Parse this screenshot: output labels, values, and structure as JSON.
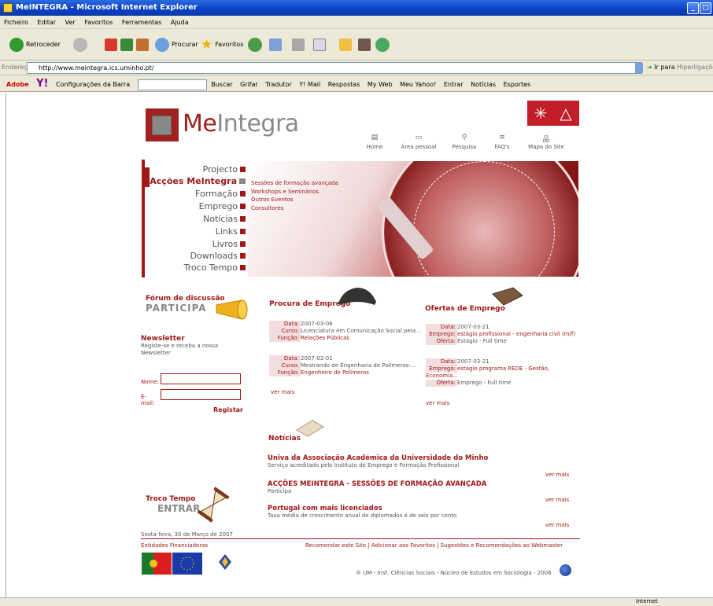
{
  "window": {
    "title": "MeINTEGRA - Microsoft Internet Explorer"
  },
  "menubar": [
    "Ficheiro",
    "Editar",
    "Ver",
    "Favoritos",
    "Ferramentas",
    "Ajuda"
  ],
  "toolbar": {
    "back": "Retroceder",
    "search": "Procurar",
    "favorites": "Favoritos"
  },
  "address": {
    "label": "Endereço",
    "url": "http://www.meintegra.ics.uminho.pt/",
    "go": "Ir para",
    "links": "Hiperligações"
  },
  "linksbar": {
    "adobe": "Adobe",
    "yahoo": "Y!",
    "config": "Configurações da Barra",
    "buscar": "Buscar",
    "grifar": "Grifar",
    "tradutor": "Tradutor",
    "ymail": "Y! Mail",
    "respostas": "Respostas",
    "myweb": "My Web",
    "meuyahoo": "Meu Yahoo!",
    "entrar": "Entrar",
    "noticias": "Notícias",
    "esportes": "Esportes"
  },
  "site": {
    "logo": {
      "prefix": "Me",
      "suffix": "Integra"
    },
    "topnav": [
      {
        "label": "Home",
        "icon": "home-icon"
      },
      {
        "label": "Área pessoal",
        "icon": "personal-icon"
      },
      {
        "label": "Pesquisa",
        "icon": "search-icon"
      },
      {
        "label": "FAQ's",
        "icon": "faq-icon"
      },
      {
        "label": "Mapa do Site",
        "icon": "sitemap-icon"
      }
    ],
    "menu": [
      "Projecto",
      "Acções MeIntegra",
      "Formação",
      "Emprego",
      "Notícias",
      "Links",
      "Livros",
      "Downloads",
      "Troco Tempo"
    ],
    "submenu": [
      "Sessões de formação avançada",
      "Workshops e Seminários",
      "Outros Eventos",
      "Consultores"
    ],
    "forum": {
      "title": "Fórum de discussão",
      "action": "PARTICIPA"
    },
    "newsletter": {
      "title": "Newsletter",
      "desc": "Registe-se e receba a nossa Newsletter",
      "name_label": "Nome:",
      "email_label": "E-mail:",
      "button": "Registar"
    },
    "procura": {
      "title": "Procura de Emprego",
      "items": [
        {
          "data": "2007-03-06",
          "curso": "Licenciatura em Comunicação Social pela...",
          "funcao": "Relações Públicas"
        },
        {
          "data": "2007-02-01",
          "curso": "Mestrando de Engenharia de Polímeros-...",
          "funcao": "Engenheiro de Polímeros"
        }
      ],
      "more": "ver mais"
    },
    "ofertas": {
      "title": "Ofertas de Emprego",
      "items": [
        {
          "data": "2007-03-21",
          "emprego": "estágio profissional - engenharia civil (m/f)",
          "oferta": "Estágio - Full time"
        },
        {
          "data": "2007-03-21",
          "emprego": "estágio programa REDE - Gestão,",
          "emprego2": "Economia...",
          "oferta": "Emprego - Full time"
        }
      ],
      "more": "ver mais"
    },
    "labels": {
      "data": "Data:",
      "curso": "Curso:",
      "funcao": "Função:",
      "emprego": "Emprego:",
      "oferta": "Oferta:"
    },
    "noticias": {
      "title": "Notícias",
      "items": [
        {
          "title": "Univa da Associação Académica da Universidade do Minho",
          "sub": "Serviço acreditado pelo Instituto de Emprego e Formação Profissional"
        },
        {
          "title": "ACÇÕES MEINTEGRA - SESSÕES DE FORMAÇÃO AVANÇADA",
          "sub": "Participa"
        },
        {
          "title": "Portugal com mais licenciados",
          "sub": "Taxa média de crescimento anual de diplomados é de seis por cento"
        }
      ],
      "more": "ver mais"
    },
    "troco": {
      "title": "Troco Tempo",
      "action": "ENTRAR"
    },
    "date": "Sexta-feira, 30 de Março de 2007",
    "footer": {
      "entidades": "Entidades Financiadoras",
      "links": "Recomendar este Site  |  Adicionar aos Favoritos  |  Sugestões e Recomendações ao Webmaster",
      "copyright": "® UM - Inst. Ciências Sociais - Núcleo de Estudos em Sociologia - 2006"
    }
  },
  "status": {
    "zone": "Internet"
  }
}
